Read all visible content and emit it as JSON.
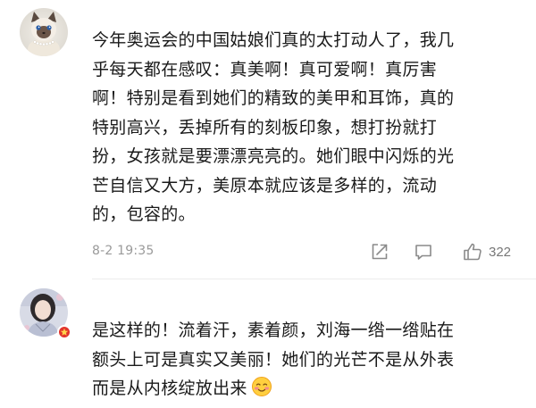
{
  "comments": [
    {
      "text": "今年奥运会的中国姑娘们真的太打动人了，我几\n乎每天都在感叹：真美啊！真可爱啊！真厉害\n啊！特别是看到她们的精致的美甲和耳饰，真的\n特别高兴，丢掉所有的刻板印象，想打扮就打\n扮，女孩就是要漂漂亮亮的。她们眼中闪烁的光\n芒自信又大方，美原本就应该是多样的，流动\n的，包容的。",
      "timestamp": "8-2 19:35",
      "likes": "322",
      "avatar_icon": "cat-avatar-icon"
    },
    {
      "text": "是这样的！流着汗，素着颜，刘海一绺一绺贴在\n额头上可是真实又美丽！她们的光芒不是从外表\n而是从内核绽放出来",
      "emoji": "blushing-face-icon",
      "avatar_icon": "girl-photo-avatar-icon",
      "badge_icon": "star-badge-icon",
      "badge_color": "#e2342c"
    }
  ],
  "icons": {
    "share": "share-icon",
    "reply": "comment-icon",
    "like": "thumbs-up-icon"
  },
  "colors": {
    "meta_text": "#9a9a9a",
    "divider": "#ececec"
  }
}
